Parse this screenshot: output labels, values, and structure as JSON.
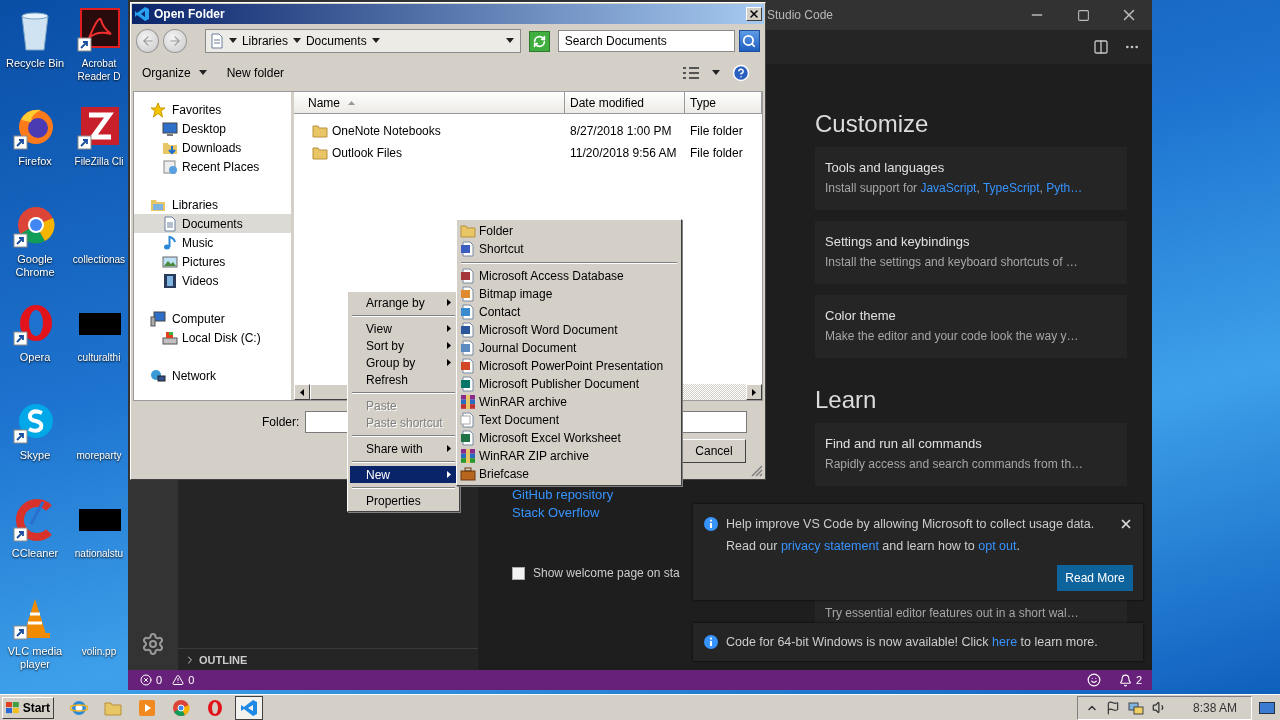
{
  "desktop": {
    "columns": [
      [
        {
          "label": "Recycle Bin",
          "kind": "recycle"
        },
        {
          "label": "Firefox",
          "kind": "firefox"
        },
        {
          "label": "Google Chrome",
          "kind": "chrome"
        },
        {
          "label": "Opera",
          "kind": "opera"
        },
        {
          "label": "Skype",
          "kind": "skype"
        },
        {
          "label": "CCleaner",
          "kind": "ccleaner"
        },
        {
          "label": "VLC media player",
          "kind": "vlc"
        }
      ],
      [
        {
          "label": "Acrobat Reader D",
          "kind": "acrobat"
        },
        {
          "label": "FileZilla Cli",
          "kind": "filezilla"
        },
        {
          "label": "collectionas",
          "kind": "blank"
        },
        {
          "label": "culturalthi",
          "kind": "redacted"
        },
        {
          "label": "moreparty",
          "kind": "blank"
        },
        {
          "label": "nationalstu",
          "kind": "redacted"
        },
        {
          "label": "volin.pp",
          "kind": "blank"
        }
      ]
    ]
  },
  "vscode": {
    "title": "Studio Code",
    "sidebar": {
      "sections": [
        {
          "label": "OUTLINE",
          "expanded": false
        }
      ]
    },
    "welcome": {
      "help_links": [
        "GitHub repository",
        "Stack Overflow"
      ],
      "startup_checkbox": {
        "label": "Show welcome page on sta",
        "checked": false
      },
      "sections": [
        {
          "heading": "Customize",
          "cards": [
            {
              "title": "Tools and languages",
              "description": [
                {
                  "text": "Install support for "
                },
                {
                  "text": "JavaScript",
                  "link": true
                },
                {
                  "text": ", "
                },
                {
                  "text": "TypeScript",
                  "link": true
                },
                {
                  "text": ", "
                },
                {
                  "text": "Pyth…",
                  "link": true
                }
              ]
            },
            {
              "title": "Settings and keybindings",
              "description": [
                {
                  "text": "Install the settings and keyboard shortcuts of …"
                }
              ]
            },
            {
              "title": "Color theme",
              "description": [
                {
                  "text": "Make the editor and your code look the way y…"
                }
              ]
            }
          ]
        },
        {
          "heading": "Learn",
          "cards": [
            {
              "title": "Find and run all commands",
              "description": [
                {
                  "text": "Rapidly access and search commands from th…"
                }
              ]
            },
            {
              "description": [
                {
                  "text": "Try essential editor features out in a short wal…"
                }
              ]
            }
          ]
        }
      ]
    },
    "notifications": [
      {
        "lines": [
          [
            {
              "text": "Help improve VS Code by allowing Microsoft to collect usage data."
            }
          ],
          [
            {
              "text": "Read our "
            },
            {
              "text": "privacy statement",
              "link": true
            },
            {
              "text": " and learn how to "
            },
            {
              "text": "opt out",
              "link": true
            },
            {
              "text": "."
            }
          ]
        ],
        "closable": true,
        "button": "Read More"
      },
      {
        "lines": [
          [
            {
              "text": "Code for 64-bit Windows is now available! Click "
            },
            {
              "text": "here",
              "link": true
            },
            {
              "text": " to learn more."
            }
          ]
        ],
        "closable": false
      }
    ],
    "status_bar": {
      "errors": "0",
      "warnings": "0",
      "notifications": "2"
    }
  },
  "dialog": {
    "title": "Open Folder",
    "breadcrumb": [
      "Libraries",
      "Documents"
    ],
    "search": {
      "placeholder": "Search Documents"
    },
    "toolbar": [
      {
        "label": "Organize",
        "dropdown": true
      },
      {
        "label": "New folder",
        "dropdown": false
      }
    ],
    "nav": [
      {
        "label": "Favorites",
        "kind": "favorites",
        "selected": false,
        "children": [
          {
            "label": "Desktop",
            "kind": "desktop",
            "selected": false
          },
          {
            "label": "Downloads",
            "kind": "downloads",
            "selected": false
          },
          {
            "label": "Recent Places",
            "kind": "recent",
            "selected": false
          }
        ]
      },
      {
        "label": "Libraries",
        "kind": "libraries",
        "selected": false,
        "children": [
          {
            "label": "Documents",
            "kind": "documents",
            "selected": true
          },
          {
            "label": "Music",
            "kind": "music",
            "selected": false
          },
          {
            "label": "Pictures",
            "kind": "pictures",
            "selected": false
          },
          {
            "label": "Videos",
            "kind": "videos",
            "selected": false
          }
        ]
      },
      {
        "label": "Computer",
        "kind": "computer",
        "selected": false,
        "children": [
          {
            "label": "Local Disk (C:)",
            "kind": "disk",
            "selected": false
          }
        ]
      },
      {
        "label": "Network",
        "kind": "network",
        "selected": false
      }
    ],
    "columns": [
      {
        "label": "Name",
        "sorted": true
      },
      {
        "label": "Date modified",
        "sorted": false
      },
      {
        "label": "Type",
        "sorted": false
      }
    ],
    "rows": [
      {
        "name": "OneNote Notebooks",
        "date": "8/27/2018 1:00 PM",
        "type": "File folder"
      },
      {
        "name": "Outlook Files",
        "date": "11/20/2018 9:56 AM",
        "type": "File folder"
      }
    ],
    "folder_label": "Folder:",
    "buttons": [
      "Cancel"
    ]
  },
  "context_menu": {
    "groups": [
      [
        {
          "label": "Arrange by",
          "submenu": true,
          "disabled": false,
          "selected": false
        }
      ],
      [
        {
          "label": "View",
          "submenu": true,
          "disabled": false,
          "selected": false
        },
        {
          "label": "Sort by",
          "submenu": true,
          "disabled": false,
          "selected": false
        },
        {
          "label": "Group by",
          "submenu": true,
          "disabled": false,
          "selected": false
        },
        {
          "label": "Refresh",
          "submenu": false,
          "disabled": false,
          "selected": false
        }
      ],
      [
        {
          "label": "Paste",
          "submenu": false,
          "disabled": true,
          "selected": false
        },
        {
          "label": "Paste shortcut",
          "submenu": false,
          "disabled": true,
          "selected": false
        }
      ],
      [
        {
          "label": "Share with",
          "submenu": true,
          "disabled": false,
          "selected": false
        }
      ],
      [
        {
          "label": "New",
          "submenu": true,
          "disabled": false,
          "selected": true
        }
      ],
      [
        {
          "label": "Properties",
          "submenu": false,
          "disabled": false,
          "selected": false
        }
      ]
    ]
  },
  "new_submenu": {
    "groups": [
      [
        {
          "label": "Folder",
          "kind": "folder"
        },
        {
          "label": "Shortcut",
          "kind": "shortcut"
        }
      ],
      [
        {
          "label": "Microsoft Access Database",
          "kind": "access"
        },
        {
          "label": "Bitmap image",
          "kind": "bitmap"
        },
        {
          "label": "Contact",
          "kind": "contact"
        },
        {
          "label": "Microsoft Word Document",
          "kind": "word"
        },
        {
          "label": "Journal Document",
          "kind": "journal"
        },
        {
          "label": "Microsoft PowerPoint Presentation",
          "kind": "powerpoint"
        },
        {
          "label": "Microsoft Publisher Document",
          "kind": "publisher"
        },
        {
          "label": "WinRAR archive",
          "kind": "winrar"
        },
        {
          "label": "Text Document",
          "kind": "text"
        },
        {
          "label": "Microsoft Excel Worksheet",
          "kind": "excel"
        },
        {
          "label": "WinRAR ZIP archive",
          "kind": "zip"
        },
        {
          "label": "Briefcase",
          "kind": "briefcase"
        }
      ]
    ]
  },
  "taskbar": {
    "start": "Start",
    "apps": [
      {
        "kind": "ie",
        "selected": false
      },
      {
        "kind": "explorer",
        "selected": false
      },
      {
        "kind": "media",
        "selected": false
      },
      {
        "kind": "chrome",
        "selected": false
      },
      {
        "kind": "opera",
        "selected": false
      },
      {
        "kind": "vscode",
        "selected": true
      }
    ],
    "clock": "8:38 AM"
  }
}
